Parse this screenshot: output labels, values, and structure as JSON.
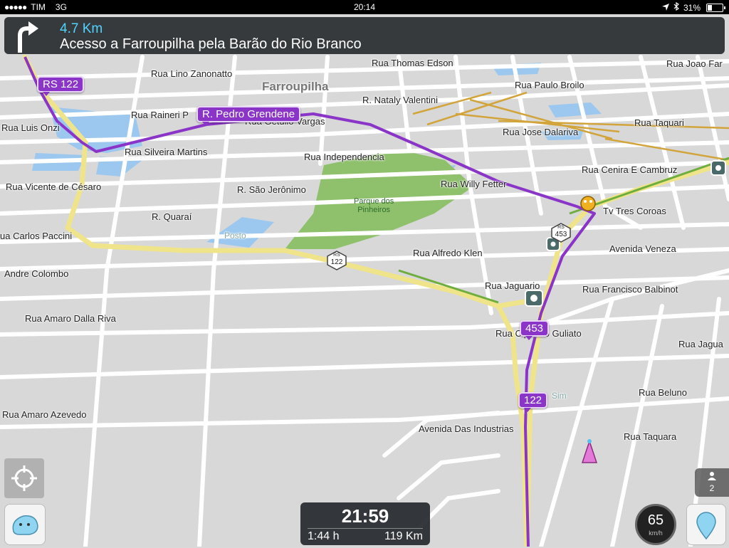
{
  "status_bar": {
    "signal_dots": "●●●●●",
    "carrier": "TIM",
    "network": "3G",
    "time": "20:14",
    "battery": "31%",
    "battery_level": 0.31,
    "location_icon": "location-arrow-icon",
    "bluetooth_icon": "bluetooth-icon"
  },
  "nav": {
    "distance": "4.7 Km",
    "instruction": "Acesso a Farroupilha pela Barão do Rio Branco",
    "turn_icon": "turn-left-arrow-icon"
  },
  "map": {
    "city_label": "Farroupilha",
    "park_label_1": "Parque dos",
    "park_label_2": "Pinheiros",
    "poi_posto": "Posto",
    "poi_sim": "Sim",
    "streets": [
      "Rua Lino Zanonatto",
      "Rua Thomas Edson",
      "Rua Joao Far",
      "Rua Paulo Broilo",
      "R. Nataly Valentini",
      "Rua Raineri P",
      "Rua Getulio Vargas",
      "Rua Luis Onzi",
      "Rua Jose Dalariva",
      "Rua Taquari",
      "Rua Silveira Martins",
      "Rua Independencia",
      "Rua Cenira E Cambruz",
      "Rua Vicente de Césaro",
      "R. São Jerônimo",
      "Rua Willy Fetter",
      "Tv Tres Coroas",
      "R. Quaraí",
      "ua Carlos Paccini",
      "Avenida Veneza",
      "Rua Alfredo Klen",
      "Andre Colombo",
      "Rua Jaguario",
      "Rua Francisco Balbinot",
      "Rua Amaro Dalla Riva",
      "Rua Cipriano Guliato",
      "Rua Jagua",
      "Rua Beluno",
      "Rua Amaro Azevedo",
      "Avenida Das Industrias",
      "Rua Taquara"
    ],
    "route_shields": {
      "rs122": "RS 122",
      "pedro": "R. Pedro Grendene",
      "s453": "453",
      "s122": "122"
    },
    "road_shields": {
      "rs": "RS",
      "n122": "122",
      "n453": "453"
    }
  },
  "eta": {
    "arrival": "21:59",
    "duration": "1:44 h",
    "distance": "119 Km"
  },
  "speedometer": {
    "speed": "65",
    "unit": "km/h"
  },
  "users_badge": {
    "count": "2"
  },
  "colors": {
    "route": "#8a35c8",
    "highway": "#f0e48a",
    "park": "#8fc06c",
    "water": "#9cc8ef",
    "banner": "#2c3034",
    "distance_text": "#4fd3ff"
  }
}
